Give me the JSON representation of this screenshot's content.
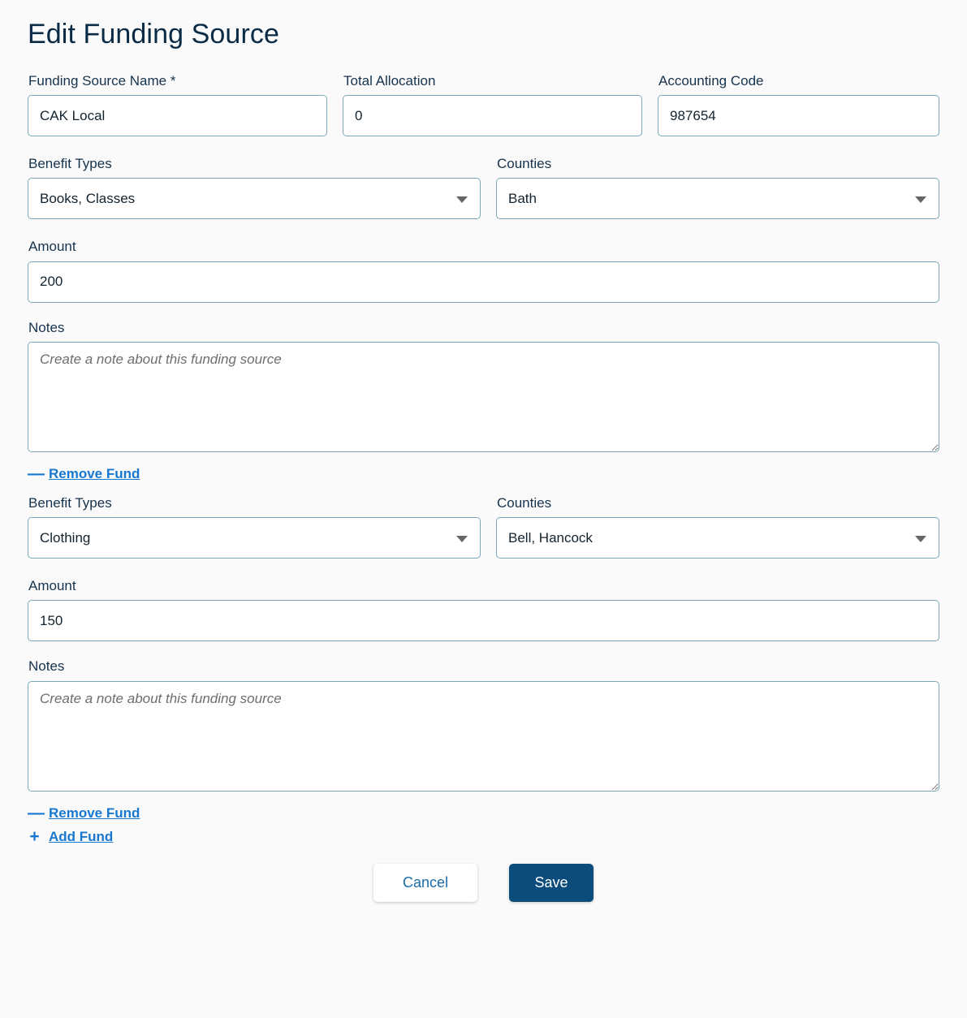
{
  "page": {
    "title": "Edit Funding Source"
  },
  "header_fields": {
    "name": {
      "label": "Funding Source Name *",
      "value": "CAK Local"
    },
    "total_allocation": {
      "label": "Total Allocation",
      "value": "0"
    },
    "accounting_code": {
      "label": "Accounting Code",
      "value": "987654"
    }
  },
  "labels": {
    "benefit_types": "Benefit Types",
    "counties": "Counties",
    "amount": "Amount",
    "notes": "Notes"
  },
  "notes_placeholder": "Create a note about this funding source",
  "funds": [
    {
      "benefit_types": "Books, Classes",
      "counties": "Bath",
      "amount": "200",
      "notes": "",
      "remove_label": "Remove Fund",
      "remove_sign": "—"
    },
    {
      "benefit_types": "Clothing",
      "counties": "Bell, Hancock",
      "amount": "150",
      "notes": "",
      "remove_label": "Remove Fund",
      "remove_sign": "—"
    }
  ],
  "add_fund": {
    "label": "Add Fund",
    "sign": "+"
  },
  "actions": {
    "cancel_label": "Cancel",
    "save_label": "Save"
  },
  "colors": {
    "accent_link": "#1878cf",
    "save_button": "#0c4c7c",
    "title": "#0a2b45",
    "border": "#7ba7bc",
    "background": "#fafafa"
  }
}
